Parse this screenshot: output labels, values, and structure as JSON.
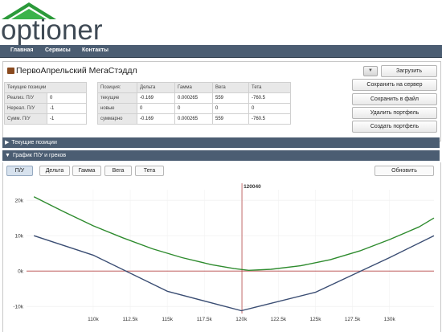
{
  "logo": {
    "text": "optioner"
  },
  "nav": {
    "items": [
      "Главная",
      "Сервисы",
      "Контакты"
    ]
  },
  "portfolio": {
    "title": "ПервоАпрельский МегаСтэддл",
    "dropdown_icon": "chevron-down-icon",
    "buttons": {
      "load": "Загрузить",
      "save_server": "Сохранить на сервер",
      "save_file": "Сохранить в файл",
      "delete": "Удалить портфель",
      "create": "Создать портфель"
    }
  },
  "positions_table": {
    "header": "Текущие позиции",
    "rows": [
      {
        "label": "Реализ. П/У",
        "value": "0"
      },
      {
        "label": "Нереал. П/У",
        "value": "-1"
      },
      {
        "label": "Сумм. П/У",
        "value": "-1"
      }
    ]
  },
  "greeks_table": {
    "headers": [
      "Позиция:",
      "Дельта",
      "Гамма",
      "Вега",
      "Тета"
    ],
    "rows": [
      [
        "текущие",
        "-0.169",
        "0.000265",
        "559",
        "-760.5"
      ],
      [
        "новые",
        "0",
        "0",
        "0",
        "0"
      ],
      [
        "суммарно",
        "-0.169",
        "0.000265",
        "559",
        "-760.5"
      ]
    ]
  },
  "sections": {
    "current_positions": "Текущие позиции",
    "chart": "График П/У и греков"
  },
  "chart_tabs": [
    "П/У",
    "Дельта",
    "Гамма",
    "Вега",
    "Тета"
  ],
  "refresh_button": "Обновить",
  "colors": {
    "nav": "#4b5d72",
    "green_series": "#2e8b2e",
    "blue_series": "#3a4d73",
    "zero_line": "#b84a4a",
    "marker": "#b84a4a"
  },
  "chart_data": {
    "type": "line",
    "marker_label": "120040",
    "marker_x": 120040,
    "xlim": [
      105500,
      133000
    ],
    "ylim": [
      -12000,
      23000
    ],
    "xticks": [
      110000,
      112500,
      115000,
      117500,
      120000,
      122500,
      125000,
      127500,
      130000
    ],
    "xtick_labels": [
      "110k",
      "112.5k",
      "115k",
      "117.5k",
      "120k",
      "122.5k",
      "125k",
      "127.5k",
      "130k"
    ],
    "yticks": [
      20000,
      10000,
      0,
      -10000
    ],
    "ytick_labels": [
      "20k",
      "10k",
      "0k",
      "-10k"
    ],
    "series": [
      {
        "points": [
          [
            106000,
            21000
          ],
          [
            108000,
            16800
          ],
          [
            110000,
            12800
          ],
          [
            112000,
            9400
          ],
          [
            114000,
            6300
          ],
          [
            116000,
            3800
          ],
          [
            118000,
            1800
          ],
          [
            119500,
            700
          ],
          [
            120500,
            200
          ],
          [
            122000,
            500
          ],
          [
            124000,
            1500
          ],
          [
            126000,
            3200
          ],
          [
            128000,
            5700
          ],
          [
            130000,
            8900
          ],
          [
            132000,
            12500
          ],
          [
            133000,
            15000
          ]
        ]
      },
      {
        "points": [
          [
            106000,
            10000
          ],
          [
            110000,
            4500
          ],
          [
            115000,
            -5700
          ],
          [
            120000,
            -11200
          ],
          [
            125000,
            -6000
          ],
          [
            130000,
            3800
          ],
          [
            133000,
            10000
          ]
        ]
      }
    ]
  }
}
